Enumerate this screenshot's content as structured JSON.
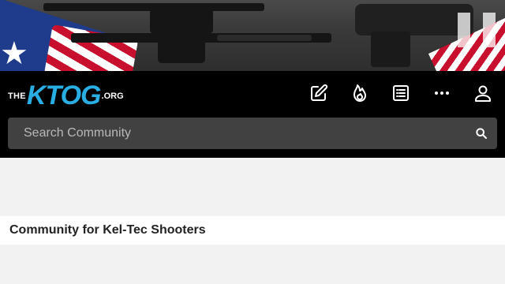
{
  "header": {
    "logo": {
      "prefix": "THE",
      "name": "KTOG",
      "suffix": ".ORG",
      "accent_color": "#29aee3"
    },
    "nav_icons": [
      "compose-icon",
      "trending-fire-icon",
      "list-icon",
      "more-icon",
      "user-icon"
    ]
  },
  "search": {
    "placeholder": "Search Community",
    "icon": "search-icon"
  },
  "main": {
    "tagline": "Community for Kel-Tec Shooters"
  },
  "colors": {
    "header_bg": "#000000",
    "search_bg": "#414141",
    "page_bg": "#f2f2f2"
  }
}
